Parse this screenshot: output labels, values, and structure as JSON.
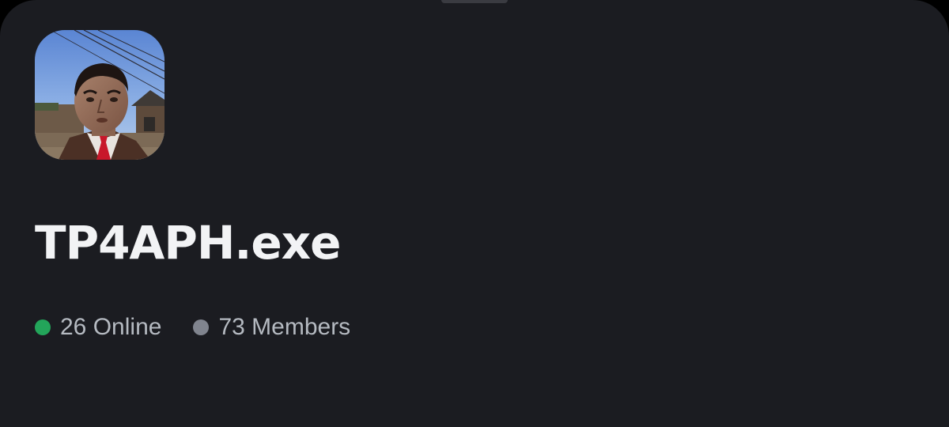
{
  "server": {
    "name": "TP4APH.exe",
    "icon": "server-avatar-image"
  },
  "stats": {
    "online_count": "26",
    "online_label": "Online",
    "members_count": "73",
    "members_label": "Members"
  },
  "colors": {
    "background": "#1b1c21",
    "title": "#f2f3f5",
    "stat_text": "#b5bac1",
    "online_dot": "#23a55a",
    "members_dot": "#80848e"
  }
}
